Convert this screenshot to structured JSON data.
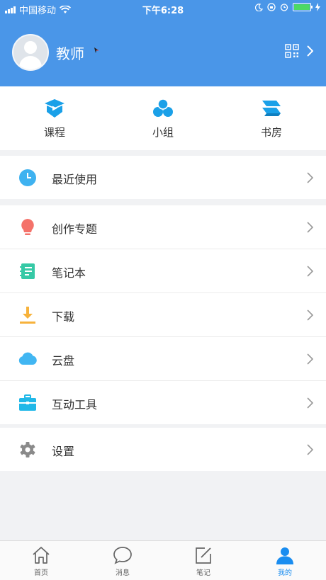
{
  "status_bar": {
    "carrier": "中国移动",
    "time": "下午6:28"
  },
  "profile": {
    "name": "教师"
  },
  "quick_actions": [
    {
      "label": "课程",
      "icon": "course-play-icon"
    },
    {
      "label": "小组",
      "icon": "group-circles-icon"
    },
    {
      "label": "书房",
      "icon": "bookshelf-icon"
    }
  ],
  "menu_groups": [
    [
      {
        "label": "最近使用",
        "icon": "clock-icon"
      }
    ],
    [
      {
        "label": "创作专题",
        "icon": "lightbulb-icon"
      },
      {
        "label": "笔记本",
        "icon": "notebook-icon"
      },
      {
        "label": "下载",
        "icon": "download-icon"
      },
      {
        "label": "云盘",
        "icon": "cloud-icon"
      },
      {
        "label": "互动工具",
        "icon": "toolbox-icon"
      }
    ],
    [
      {
        "label": "设置",
        "icon": "gear-icon"
      }
    ]
  ],
  "tabbar": [
    {
      "label": "首页",
      "icon": "home-icon",
      "active": false
    },
    {
      "label": "消息",
      "icon": "message-icon",
      "active": false
    },
    {
      "label": "笔记",
      "icon": "note-edit-icon",
      "active": false
    },
    {
      "label": "我的",
      "icon": "person-icon",
      "active": true
    }
  ],
  "colors": {
    "header_bg": "#4a96e8",
    "active_tab": "#1a8df0",
    "page_bg": "#f1f2f4"
  }
}
